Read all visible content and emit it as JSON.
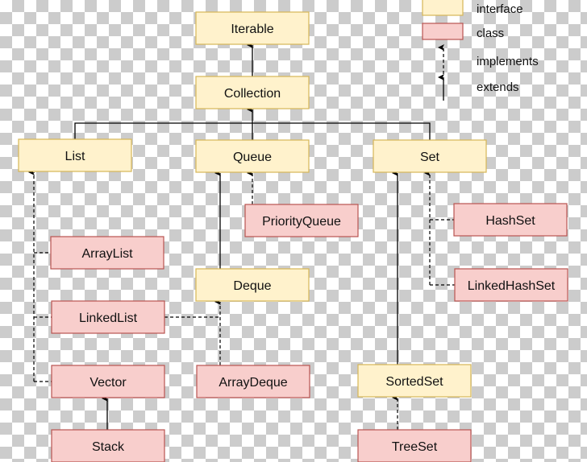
{
  "legend": {
    "interface": "interface",
    "class": "class",
    "implements": "implements",
    "extends": "extends",
    "colors": {
      "interface_fill": "#fff2cc",
      "interface_border": "#d6b656",
      "class_fill": "#f8cecc",
      "class_border": "#b85450"
    }
  },
  "nodes": {
    "iterable": {
      "label": "Iterable",
      "kind": "interface"
    },
    "collection": {
      "label": "Collection",
      "kind": "interface"
    },
    "list": {
      "label": "List",
      "kind": "interface"
    },
    "queue": {
      "label": "Queue",
      "kind": "interface"
    },
    "set": {
      "label": "Set",
      "kind": "interface"
    },
    "priority_queue": {
      "label": "PriorityQueue",
      "kind": "class"
    },
    "hash_set": {
      "label": "HashSet",
      "kind": "class"
    },
    "array_list": {
      "label": "ArrayList",
      "kind": "class"
    },
    "deque": {
      "label": "Deque",
      "kind": "interface"
    },
    "linked_hash_set": {
      "label": "LinkedHashSet",
      "kind": "class"
    },
    "linked_list": {
      "label": "LinkedList",
      "kind": "class"
    },
    "vector": {
      "label": "Vector",
      "kind": "class"
    },
    "array_deque": {
      "label": "ArrayDeque",
      "kind": "class"
    },
    "sorted_set": {
      "label": "SortedSet",
      "kind": "interface"
    },
    "stack": {
      "label": "Stack",
      "kind": "class"
    },
    "tree_set": {
      "label": "TreeSet",
      "kind": "class"
    }
  },
  "edges": [
    {
      "from": "collection",
      "to": "iterable",
      "type": "extends"
    },
    {
      "from": "list",
      "to": "collection",
      "type": "extends"
    },
    {
      "from": "queue",
      "to": "collection",
      "type": "extends"
    },
    {
      "from": "set",
      "to": "collection",
      "type": "extends"
    },
    {
      "from": "array_list",
      "to": "list",
      "type": "implements"
    },
    {
      "from": "linked_list",
      "to": "list",
      "type": "implements"
    },
    {
      "from": "vector",
      "to": "list",
      "type": "implements"
    },
    {
      "from": "stack",
      "to": "vector",
      "type": "extends"
    },
    {
      "from": "priority_queue",
      "to": "queue",
      "type": "implements"
    },
    {
      "from": "deque",
      "to": "queue",
      "type": "extends"
    },
    {
      "from": "linked_list",
      "to": "deque",
      "type": "implements"
    },
    {
      "from": "array_deque",
      "to": "deque",
      "type": "implements"
    },
    {
      "from": "hash_set",
      "to": "set",
      "type": "implements"
    },
    {
      "from": "linked_hash_set",
      "to": "set",
      "type": "implements"
    },
    {
      "from": "sorted_set",
      "to": "set",
      "type": "extends"
    },
    {
      "from": "tree_set",
      "to": "sorted_set",
      "type": "implements"
    }
  ]
}
